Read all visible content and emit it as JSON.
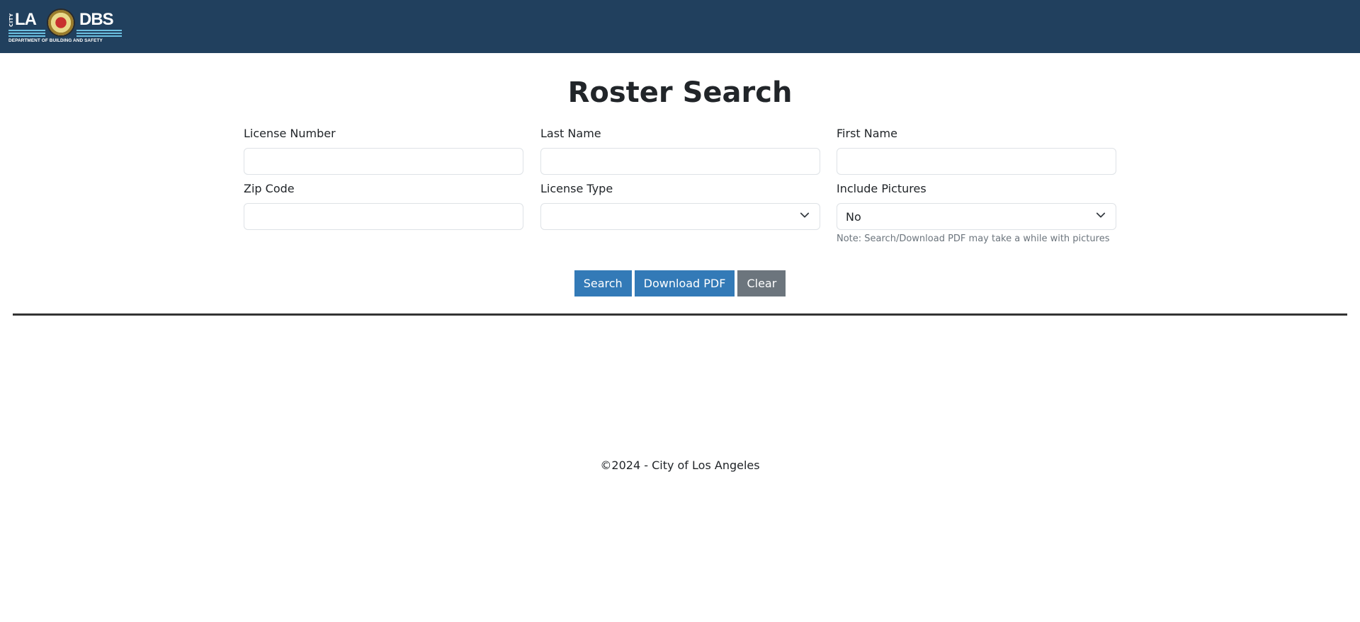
{
  "header": {
    "logo": {
      "city": "CITY",
      "la": "LA",
      "dbs": "DBS",
      "department": "DEPARTMENT OF BUILDING AND SAFETY"
    }
  },
  "page": {
    "title": "Roster Search"
  },
  "form": {
    "license_number": {
      "label": "License Number",
      "value": ""
    },
    "last_name": {
      "label": "Last Name",
      "value": ""
    },
    "first_name": {
      "label": "First Name",
      "value": ""
    },
    "zip_code": {
      "label": "Zip Code",
      "value": ""
    },
    "license_type": {
      "label": "License Type",
      "selected": ""
    },
    "include_pictures": {
      "label": "Include Pictures",
      "selected": "No",
      "note": "Note: Search/Download PDF may take a while with pictures"
    }
  },
  "buttons": {
    "search": "Search",
    "download_pdf": "Download PDF",
    "clear": "Clear"
  },
  "colors": {
    "header_bg": "#21405e",
    "primary": "#337ab7",
    "secondary": "#6c757d"
  },
  "footer": {
    "text": "©2024 - City of Los Angeles"
  }
}
